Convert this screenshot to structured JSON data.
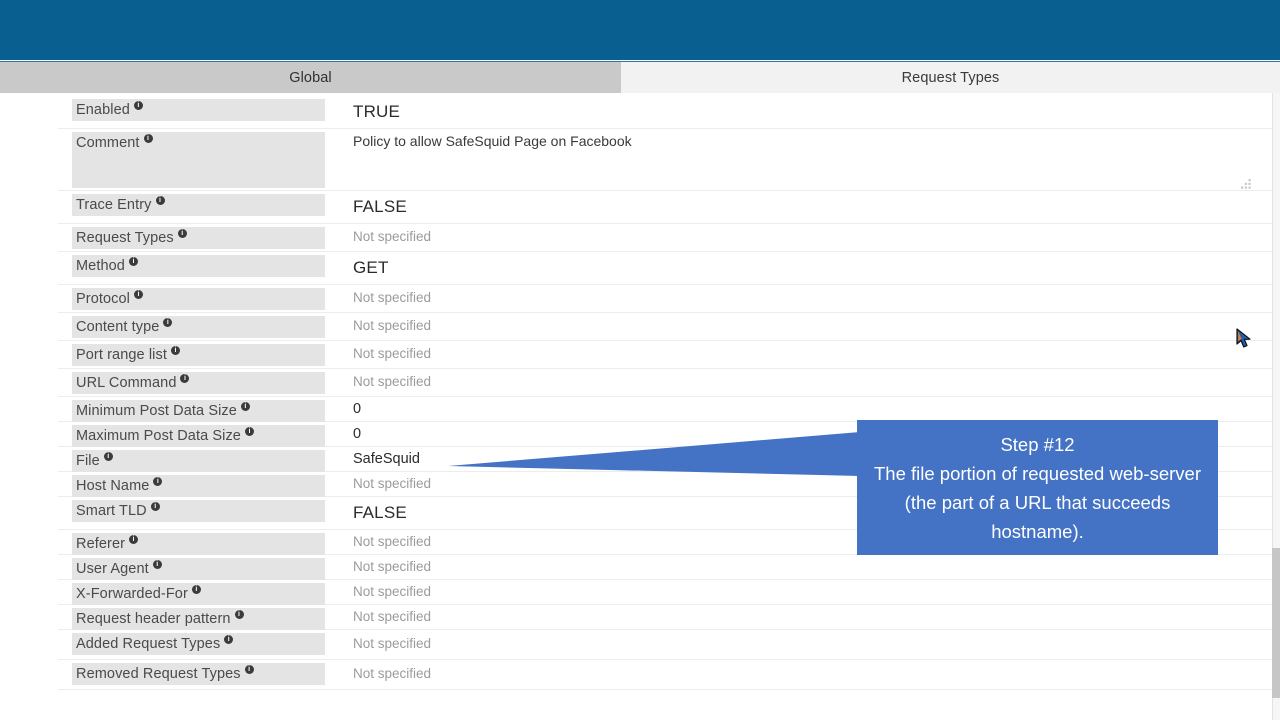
{
  "theme": {
    "header_blue": "#0a5f91",
    "active_tab_gray": "#c9c9c9",
    "label_gray": "#e4e4e4",
    "callout_blue": "#4472c4",
    "save_blue": "#1b6ca8",
    "delete_orange": "#ef6721",
    "reset_gray": "#5f5f5f"
  },
  "tabs": [
    {
      "label": "Global",
      "active": true
    },
    {
      "label": "Request Types",
      "active": false
    }
  ],
  "actions": [
    {
      "name": "save",
      "icon": "checkbox-icon"
    },
    {
      "name": "delete",
      "icon": "close-x-icon"
    },
    {
      "name": "reset",
      "icon": "undo-arrow-icon"
    }
  ],
  "info_glyph": "i",
  "fields": [
    {
      "label": "Enabled",
      "value": "TRUE",
      "style": "strong"
    },
    {
      "label": "Comment",
      "value": "Policy to allow SafeSquid Page on Facebook",
      "style": "comment"
    },
    {
      "label": "Trace Entry",
      "value": "FALSE",
      "style": "strong"
    },
    {
      "label": "Request Types",
      "value": "Not specified",
      "style": "placeholder"
    },
    {
      "label": "Method",
      "value": "GET",
      "style": "strong"
    },
    {
      "label": "Protocol",
      "value": "Not specified",
      "style": "placeholder"
    },
    {
      "label": "Content type",
      "value": "Not specified",
      "style": "placeholder"
    },
    {
      "label": "Port range list",
      "value": "Not specified",
      "style": "placeholder"
    },
    {
      "label": "URL Command",
      "value": "Not specified",
      "style": "placeholder"
    },
    {
      "label": "Minimum Post Data Size",
      "value": "0",
      "style": "plain"
    },
    {
      "label": "Maximum Post Data Size",
      "value": "0",
      "style": "plain"
    },
    {
      "label": "File",
      "value": "SafeSquid",
      "style": "plain"
    },
    {
      "label": "Host Name",
      "value": "Not specified",
      "style": "placeholder"
    },
    {
      "label": "Smart TLD",
      "value": "FALSE",
      "style": "strong"
    },
    {
      "label": "Referer",
      "value": "Not specified",
      "style": "placeholder"
    },
    {
      "label": "User Agent",
      "value": "Not specified",
      "style": "placeholder"
    },
    {
      "label": "X-Forwarded-For",
      "value": "Not specified",
      "style": "placeholder"
    },
    {
      "label": "Request header pattern",
      "value": "Not specified",
      "style": "placeholder"
    },
    {
      "label": "Added Request Types",
      "value": "Not specified",
      "style": "placeholder"
    },
    {
      "label": "Removed Request Types",
      "value": "Not specified",
      "style": "placeholder"
    }
  ],
  "callout": {
    "title": "Step #12",
    "body": "The file portion of requested web-server (the part of a URL that succeeds hostname).",
    "points_at_field": "File"
  }
}
